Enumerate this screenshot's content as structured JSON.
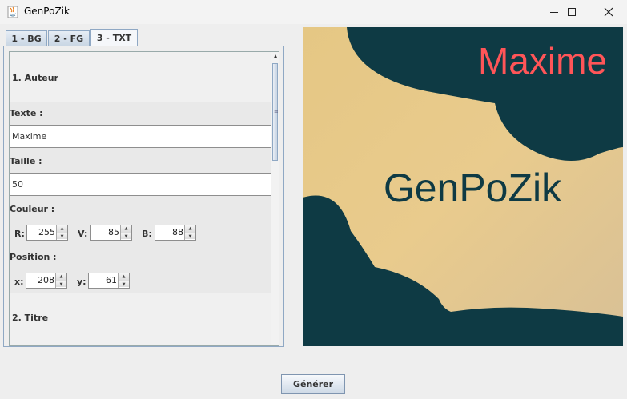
{
  "window": {
    "title": "GenPoZik"
  },
  "tabs": [
    {
      "label": "1 - BG"
    },
    {
      "label": "2 - FG"
    },
    {
      "label": "3 - TXT"
    }
  ],
  "author_section": {
    "heading": "1. Auteur",
    "text_label": "Texte :",
    "text_value": "Maxime",
    "size_label": "Taille :",
    "size_value": "50",
    "color_label": "Couleur :",
    "r_label": "R:",
    "r_value": "255",
    "v_label": "V:",
    "v_value": "85",
    "b_label": "B:",
    "b_value": "88",
    "position_label": "Position :",
    "x_label": "x:",
    "x_value": "208",
    "y_label": "y:",
    "y_value": "61"
  },
  "title_section": {
    "heading": "2. Titre"
  },
  "preview": {
    "author_text": "Maxime",
    "title_text": "GenPoZik",
    "author_color": "#ff5558",
    "title_color": "#0e3a44",
    "bg_color": "#e8c98a",
    "shape_color": "#0e3a44"
  },
  "footer": {
    "generate_label": "Générer"
  }
}
